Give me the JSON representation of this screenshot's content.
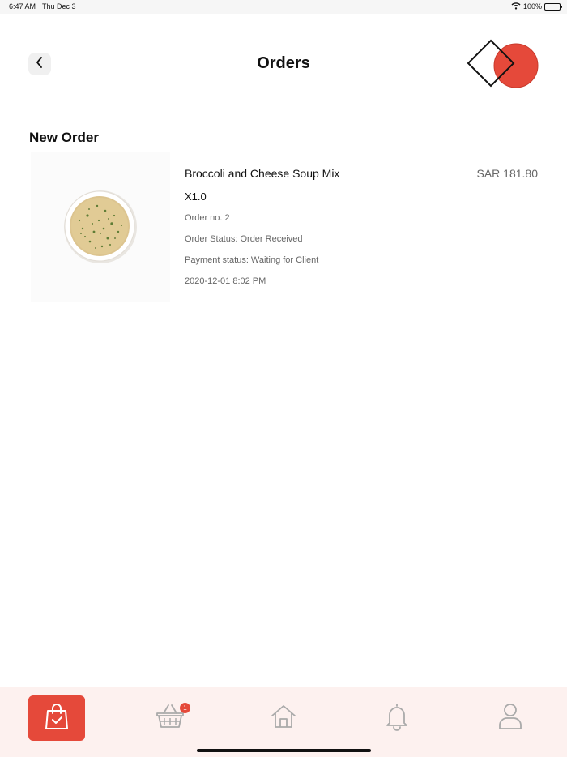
{
  "status_bar": {
    "time": "6:47 AM",
    "date": "Thu Dec 3",
    "battery": "100%",
    "icons": [
      "wifi-icon",
      "battery-icon"
    ]
  },
  "header": {
    "title": "Orders",
    "back_icon": "chevron-left-icon",
    "logo": "brand-logo"
  },
  "section": {
    "title": "New Order"
  },
  "orders": [
    {
      "name": "Broccoli and Cheese Soup Mix",
      "price": "SAR 181.80",
      "quantity": "X1.0",
      "order_no": "Order no. 2",
      "status": "Order Status: Order Received",
      "payment": "Payment status: Waiting for Client",
      "date": "2020-12-01 8:02 PM",
      "image": "soup-bowl-image"
    }
  ],
  "tab_bar": {
    "tabs": [
      {
        "name": "orders",
        "icon": "shopping-bag-icon",
        "active": true
      },
      {
        "name": "basket",
        "icon": "basket-icon",
        "badge": "1"
      },
      {
        "name": "home",
        "icon": "home-icon"
      },
      {
        "name": "notifications",
        "icon": "bell-icon"
      },
      {
        "name": "profile",
        "icon": "user-icon"
      }
    ]
  },
  "colors": {
    "accent": "#e5493a",
    "tab_bar_bg": "#fdf1ef",
    "muted_text": "#666666"
  }
}
